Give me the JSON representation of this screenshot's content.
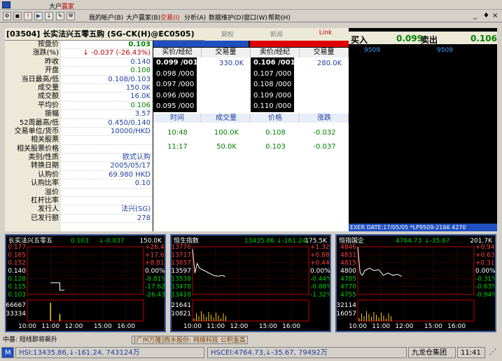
{
  "window": {
    "title_prefix": "大户",
    "title_red": "赢家"
  },
  "menu": [
    "我的帐户(B)",
    "大户赢家(B)",
    "交易(I)",
    "分析(A)",
    "数据维护(D)",
    "窗口(W)",
    "帮助(H)"
  ],
  "menu_active_index": 2,
  "window_controls": [
    "_",
    "♦",
    "×"
  ],
  "toolbar_icons": [
    "settings-icon",
    "copy-icon",
    "alert-icon",
    "play-icon",
    "download-icon",
    "tool-icon",
    "hammer-icon",
    "sh-icon",
    "chart-icon",
    "hk-icon",
    "star-icon",
    "flag-icon",
    "save-icon",
    "calc-icon",
    "print-icon"
  ],
  "stock": {
    "title": "[03504] 长实法兴五零五购 (SG-CK(H)@EC0505)",
    "tabs": [
      "期权",
      "新闻",
      "Link"
    ]
  },
  "fields": [
    {
      "label": "按盘价",
      "value": "0.103",
      "style": "green"
    },
    {
      "label": "涨跌(%)",
      "value": "↓ -0.037 (-26.43%)",
      "style": "red"
    },
    {
      "label": "昨收",
      "value": "0.140",
      "style": ""
    },
    {
      "label": "开盘",
      "value": "0.108",
      "style": "green2"
    },
    {
      "label": "当日最高/低",
      "value": "0.108/0.103",
      "style": ""
    },
    {
      "label": "成交量",
      "value": "150.0K",
      "style": ""
    },
    {
      "label": "成交额",
      "value": "16.0K",
      "style": ""
    },
    {
      "label": "平均价",
      "value": "0.106",
      "style": "green2"
    },
    {
      "label": "振幅",
      "value": "3.57",
      "style": ""
    },
    {
      "label": "52周最高/低",
      "value": "0.450/0.140",
      "style": ""
    },
    {
      "label": "交易单位/货币",
      "value": "10000/HKD",
      "style": ""
    },
    {
      "label": "相关股票",
      "value": "",
      "style": ""
    },
    {
      "label": "相关股票价格",
      "value": "",
      "style": ""
    },
    {
      "label": "类别/性质",
      "value": "欧式认购",
      "style": ""
    },
    {
      "label": "转换日期",
      "value": "2005/05/17",
      "style": ""
    },
    {
      "label": "认购价",
      "value": "69.980 HKD",
      "style": ""
    },
    {
      "label": "认购比率",
      "value": "0.10",
      "style": ""
    },
    {
      "label": "溢价",
      "value": "",
      "style": ""
    },
    {
      "label": "杠杆比率",
      "value": "",
      "style": ""
    },
    {
      "label": "发行人",
      "value": "法兴(SG)",
      "style": ""
    },
    {
      "label": "已发行额",
      "value": "278",
      "style": ""
    }
  ],
  "orderbook": {
    "headers": [
      "买价/经纪",
      "交易量",
      "卖价/经纪",
      "交易量"
    ],
    "bids": [
      "0.099 /001",
      "0.098 /000",
      "0.097 /000",
      "0.096 /000",
      "0.095 /000"
    ],
    "asks": [
      "0.106 /001",
      "0.107 /000",
      "0.108 /000",
      "0.109 /000",
      "0.110 /000"
    ],
    "bid_vol": "330.0K",
    "ask_vol": "280.0K"
  },
  "trades": {
    "headers": [
      "时间",
      "成交量",
      "价格",
      "涨跌"
    ],
    "rows": [
      [
        "10:48",
        "100.0K",
        "0.108",
        "-0.032"
      ],
      [
        "11:17",
        "50.0K",
        "0.103",
        "-0.037"
      ]
    ]
  },
  "quote": {
    "buy_label": "买入",
    "buy_price": "0.099",
    "sell_label": "卖出",
    "sell_price": "0.106",
    "buy_broker": "9509",
    "sell_broker": "9509",
    "exer": "EXER DATE:17/05/05 *LP9509-2166 4270"
  },
  "charts": [
    {
      "title": "长实法兴五零五",
      "price": "0.103",
      "change": "↓-0.037",
      "volume": "150.0K",
      "left_labels": [
        "0.177",
        "0.165",
        "0.152",
        "0.140",
        "0.128",
        "0.115",
        "0.103"
      ],
      "right_labels": [
        "+26.43%",
        "+17.62%",
        "+8.81%",
        "0.00%",
        "-8.81%",
        "-17.62%",
        "-26.43%"
      ],
      "vol_labels": [
        "66667",
        "33334"
      ],
      "times": [
        "10:00",
        "11:00",
        "12:00",
        "15:00",
        "16:00"
      ]
    },
    {
      "title": "恒生指数",
      "price": "13435.86",
      "change": "↓-161.24",
      "volume": "175.5K",
      "left_labels": [
        "13776",
        "13717",
        "13657",
        "13597",
        "13538",
        "13478",
        "13418"
      ],
      "right_labels": [
        "+1.32%",
        "+0.88%",
        "+0.44%",
        "0.00%",
        "-0.44%",
        "-0.88%",
        "-1.32%"
      ],
      "vol_labels": [
        "21641",
        "10821"
      ],
      "times": [
        "10:00",
        "11:00",
        "12:00",
        "15:00",
        "16:00"
      ]
    },
    {
      "title": "恒指国企",
      "price": "4764.73",
      "change": "↓-35.67",
      "volume": "201.7K",
      "left_labels": [
        "4846",
        "4831",
        "4815",
        "4800",
        "4785",
        "4770",
        "4755"
      ],
      "right_labels": [
        "+0.94%",
        "+0.63%",
        "+0.31%",
        "0.00%",
        "-0.31%",
        "-0.63%",
        "-0.94%"
      ],
      "vol_labels": [
        "32114",
        "16057"
      ],
      "times": [
        "10:00",
        "11:00",
        "12:00",
        "15:00",
        "16:00"
      ]
    }
  ],
  "news": {
    "left": "中基: 短线即将飙升",
    "right": "[广州万隆]西水股份: 网络科技 公积金高"
  },
  "status": {
    "hsi": "HSI:13435.86,↓-161.24, 743124万",
    "hscei": "HSCEI:4764.73,↓-35.67, 79492万",
    "company": "九龙仓集团",
    "time": "11:41"
  }
}
